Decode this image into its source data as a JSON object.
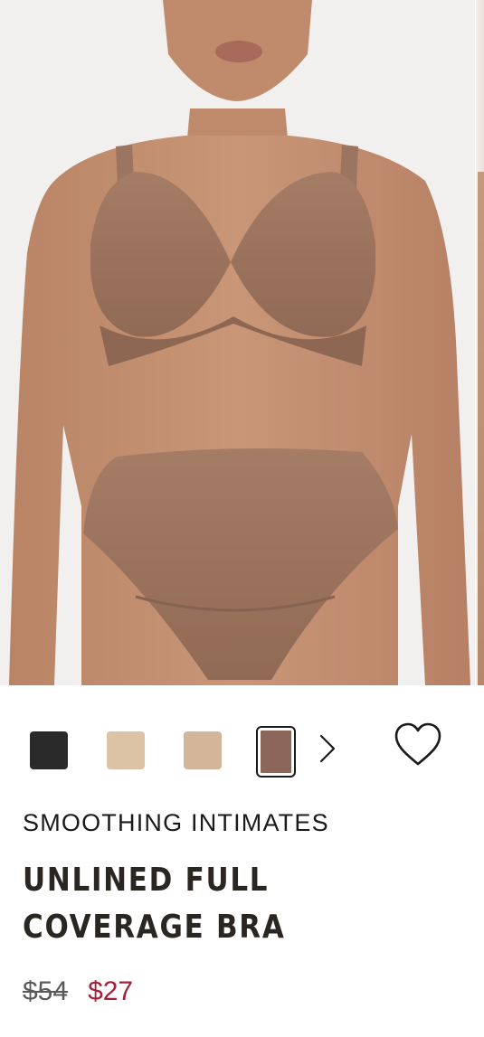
{
  "product": {
    "image_alt": "Model wearing unlined full coverage bra and brief",
    "collection": "SMOOTHING INTIMATES",
    "title": "UNLINED FULL COVERAGE BRA",
    "price_original": "$54",
    "price_sale": "$27"
  },
  "swatches": [
    {
      "color": "#2a2a2a"
    },
    {
      "color": "#dcc3a6"
    },
    {
      "color": "#d3b59a"
    },
    {
      "color": "#8c6658",
      "selected": true
    }
  ],
  "icons": {
    "next_swatches": "chevron-right-icon",
    "wishlist": "heart-outline-icon"
  },
  "colors": {
    "sale_price": "#a3203a",
    "original_price": "#5a5a5a",
    "text": "#1a1a1a"
  }
}
